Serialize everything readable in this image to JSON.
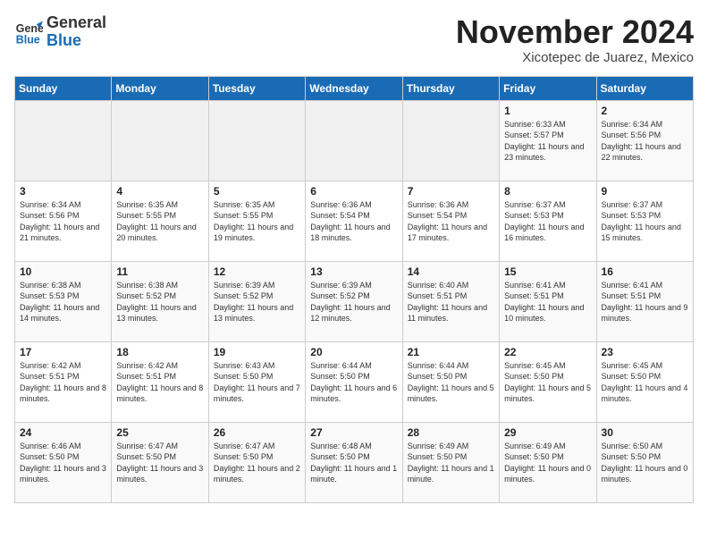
{
  "logo": {
    "general": "General",
    "blue": "Blue"
  },
  "title": "November 2024",
  "subtitle": "Xicotepec de Juarez, Mexico",
  "weekdays": [
    "Sunday",
    "Monday",
    "Tuesday",
    "Wednesday",
    "Thursday",
    "Friday",
    "Saturday"
  ],
  "weeks": [
    [
      {
        "num": "",
        "info": ""
      },
      {
        "num": "",
        "info": ""
      },
      {
        "num": "",
        "info": ""
      },
      {
        "num": "",
        "info": ""
      },
      {
        "num": "",
        "info": ""
      },
      {
        "num": "1",
        "info": "Sunrise: 6:33 AM\nSunset: 5:57 PM\nDaylight: 11 hours\nand 23 minutes."
      },
      {
        "num": "2",
        "info": "Sunrise: 6:34 AM\nSunset: 5:56 PM\nDaylight: 11 hours\nand 22 minutes."
      }
    ],
    [
      {
        "num": "3",
        "info": "Sunrise: 6:34 AM\nSunset: 5:56 PM\nDaylight: 11 hours\nand 21 minutes."
      },
      {
        "num": "4",
        "info": "Sunrise: 6:35 AM\nSunset: 5:55 PM\nDaylight: 11 hours\nand 20 minutes."
      },
      {
        "num": "5",
        "info": "Sunrise: 6:35 AM\nSunset: 5:55 PM\nDaylight: 11 hours\nand 19 minutes."
      },
      {
        "num": "6",
        "info": "Sunrise: 6:36 AM\nSunset: 5:54 PM\nDaylight: 11 hours\nand 18 minutes."
      },
      {
        "num": "7",
        "info": "Sunrise: 6:36 AM\nSunset: 5:54 PM\nDaylight: 11 hours\nand 17 minutes."
      },
      {
        "num": "8",
        "info": "Sunrise: 6:37 AM\nSunset: 5:53 PM\nDaylight: 11 hours\nand 16 minutes."
      },
      {
        "num": "9",
        "info": "Sunrise: 6:37 AM\nSunset: 5:53 PM\nDaylight: 11 hours\nand 15 minutes."
      }
    ],
    [
      {
        "num": "10",
        "info": "Sunrise: 6:38 AM\nSunset: 5:53 PM\nDaylight: 11 hours\nand 14 minutes."
      },
      {
        "num": "11",
        "info": "Sunrise: 6:38 AM\nSunset: 5:52 PM\nDaylight: 11 hours\nand 13 minutes."
      },
      {
        "num": "12",
        "info": "Sunrise: 6:39 AM\nSunset: 5:52 PM\nDaylight: 11 hours\nand 13 minutes."
      },
      {
        "num": "13",
        "info": "Sunrise: 6:39 AM\nSunset: 5:52 PM\nDaylight: 11 hours\nand 12 minutes."
      },
      {
        "num": "14",
        "info": "Sunrise: 6:40 AM\nSunset: 5:51 PM\nDaylight: 11 hours\nand 11 minutes."
      },
      {
        "num": "15",
        "info": "Sunrise: 6:41 AM\nSunset: 5:51 PM\nDaylight: 11 hours\nand 10 minutes."
      },
      {
        "num": "16",
        "info": "Sunrise: 6:41 AM\nSunset: 5:51 PM\nDaylight: 11 hours\nand 9 minutes."
      }
    ],
    [
      {
        "num": "17",
        "info": "Sunrise: 6:42 AM\nSunset: 5:51 PM\nDaylight: 11 hours\nand 8 minutes."
      },
      {
        "num": "18",
        "info": "Sunrise: 6:42 AM\nSunset: 5:51 PM\nDaylight: 11 hours\nand 8 minutes."
      },
      {
        "num": "19",
        "info": "Sunrise: 6:43 AM\nSunset: 5:50 PM\nDaylight: 11 hours\nand 7 minutes."
      },
      {
        "num": "20",
        "info": "Sunrise: 6:44 AM\nSunset: 5:50 PM\nDaylight: 11 hours\nand 6 minutes."
      },
      {
        "num": "21",
        "info": "Sunrise: 6:44 AM\nSunset: 5:50 PM\nDaylight: 11 hours\nand 5 minutes."
      },
      {
        "num": "22",
        "info": "Sunrise: 6:45 AM\nSunset: 5:50 PM\nDaylight: 11 hours\nand 5 minutes."
      },
      {
        "num": "23",
        "info": "Sunrise: 6:45 AM\nSunset: 5:50 PM\nDaylight: 11 hours\nand 4 minutes."
      }
    ],
    [
      {
        "num": "24",
        "info": "Sunrise: 6:46 AM\nSunset: 5:50 PM\nDaylight: 11 hours\nand 3 minutes."
      },
      {
        "num": "25",
        "info": "Sunrise: 6:47 AM\nSunset: 5:50 PM\nDaylight: 11 hours\nand 3 minutes."
      },
      {
        "num": "26",
        "info": "Sunrise: 6:47 AM\nSunset: 5:50 PM\nDaylight: 11 hours\nand 2 minutes."
      },
      {
        "num": "27",
        "info": "Sunrise: 6:48 AM\nSunset: 5:50 PM\nDaylight: 11 hours\nand 1 minute."
      },
      {
        "num": "28",
        "info": "Sunrise: 6:49 AM\nSunset: 5:50 PM\nDaylight: 11 hours\nand 1 minute."
      },
      {
        "num": "29",
        "info": "Sunrise: 6:49 AM\nSunset: 5:50 PM\nDaylight: 11 hours\nand 0 minutes."
      },
      {
        "num": "30",
        "info": "Sunrise: 6:50 AM\nSunset: 5:50 PM\nDaylight: 11 hours\nand 0 minutes."
      }
    ]
  ]
}
